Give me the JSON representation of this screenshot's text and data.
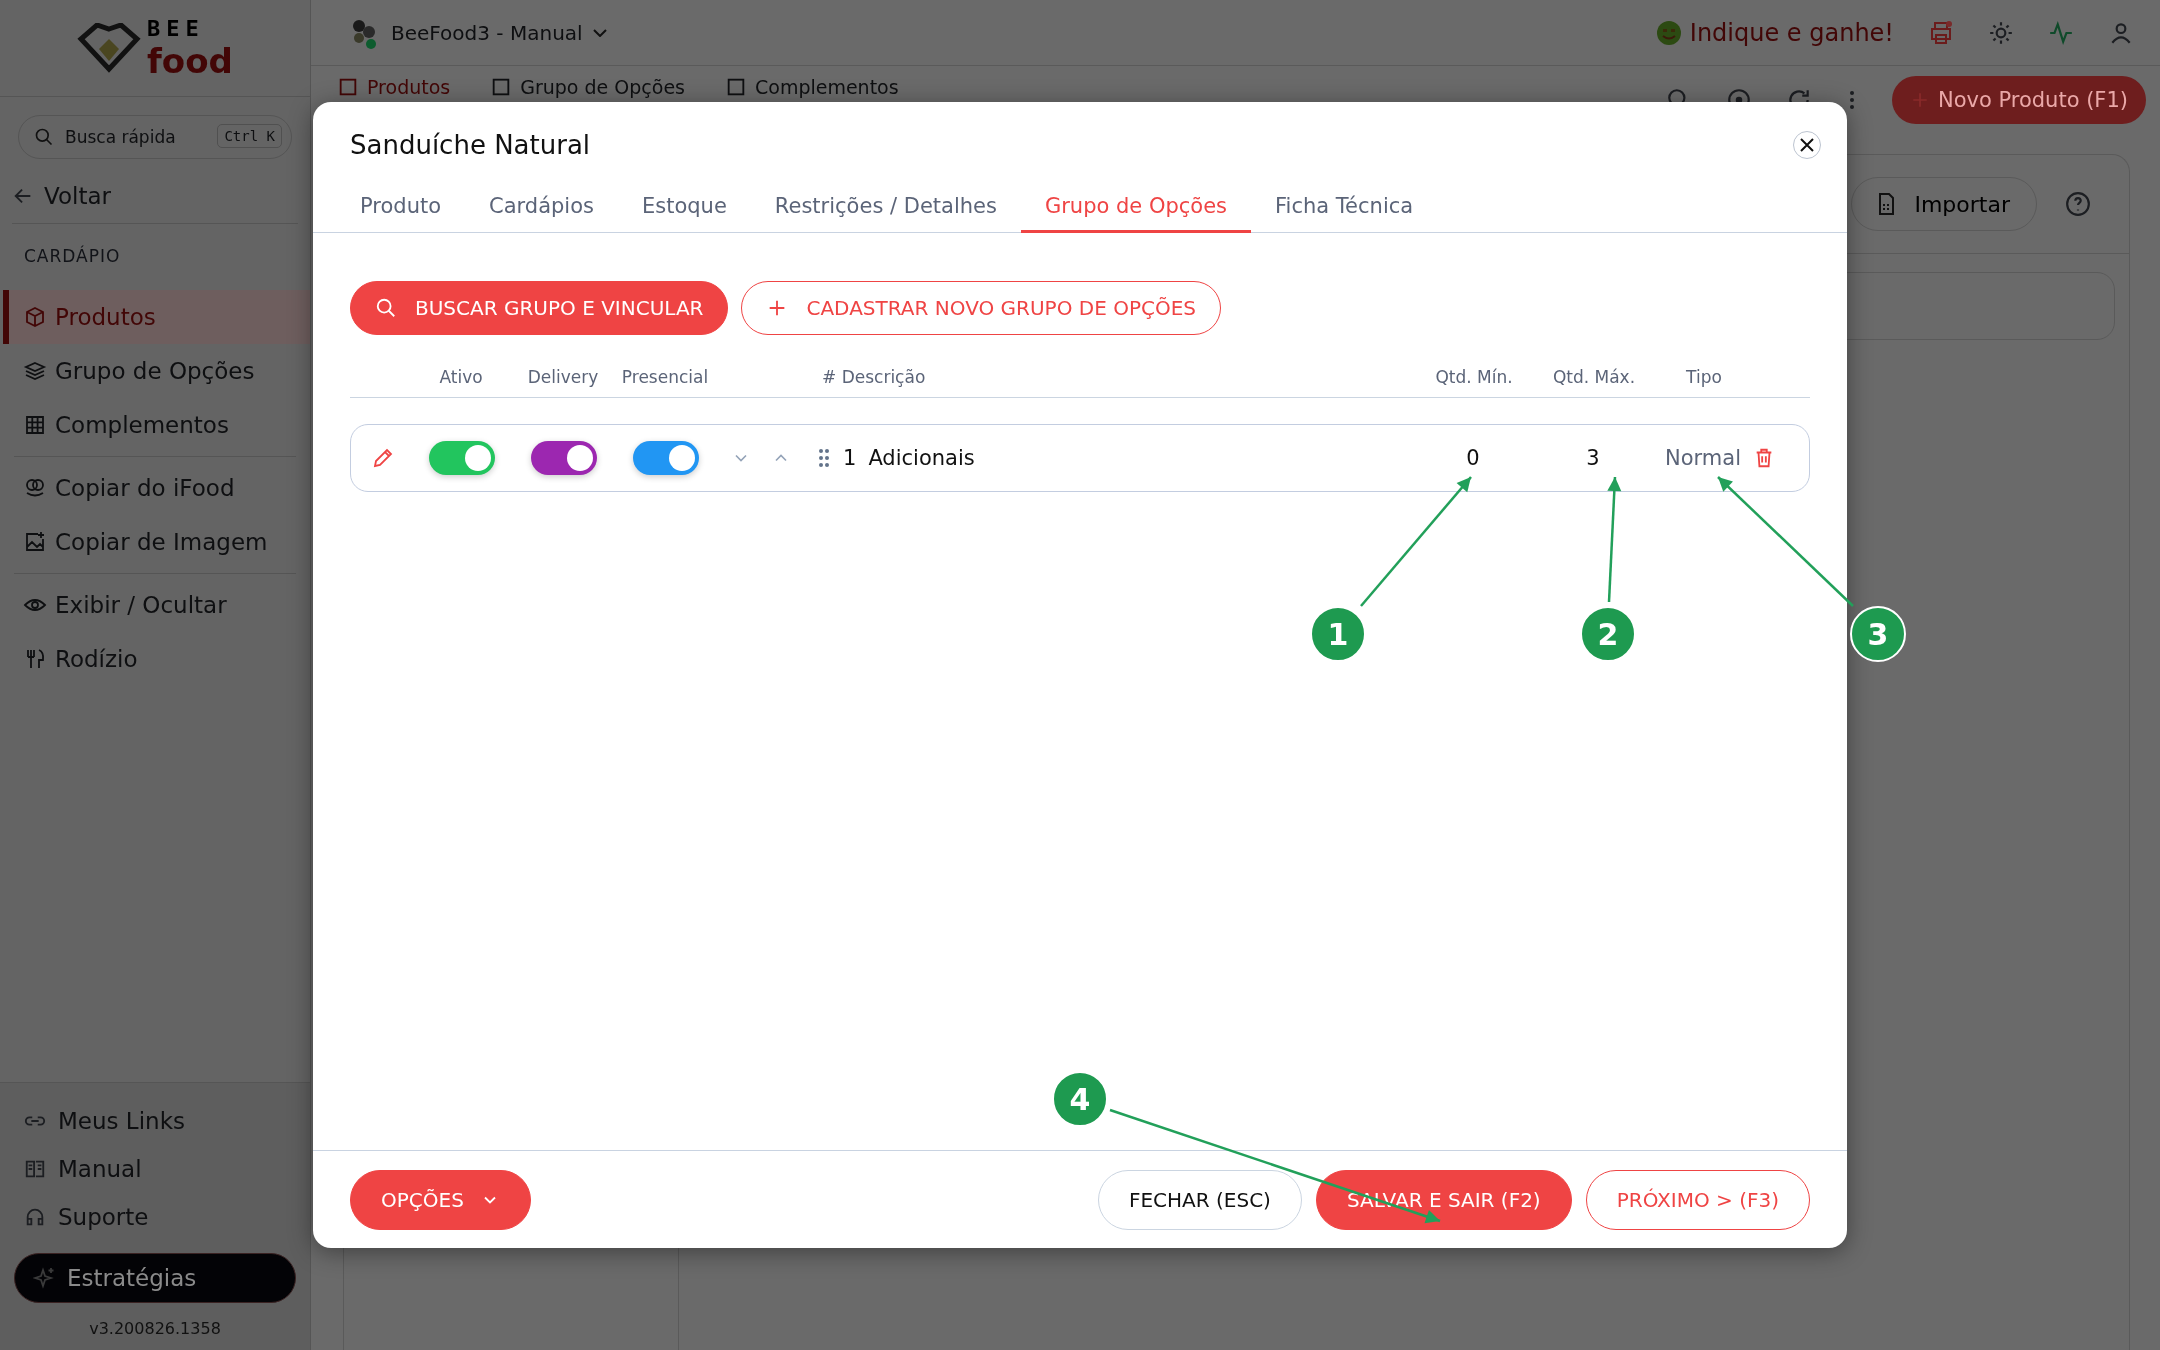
{
  "sidebar": {
    "logo": {
      "top": "BEE",
      "bottom": "food"
    },
    "search": {
      "placeholder": "Busca rápida",
      "shortcut": "Ctrl K"
    },
    "back": "Voltar",
    "section": "CARDÁPIO",
    "groups": [
      {
        "items": [
          {
            "label": "Produtos",
            "selected": true
          },
          {
            "label": "Grupo de Opções",
            "selected": false
          },
          {
            "label": "Complementos",
            "selected": false
          }
        ]
      },
      {
        "items": [
          {
            "label": "Copiar do iFood",
            "selected": false
          },
          {
            "label": "Copiar de Imagem",
            "selected": false
          }
        ]
      },
      {
        "items": [
          {
            "label": "Exibir / Ocultar",
            "selected": false
          },
          {
            "label": "Rodízio",
            "selected": false
          }
        ]
      }
    ],
    "footer_items": [
      "Meus Links",
      "Manual",
      "Suporte"
    ],
    "strategy_button": "Estratégias",
    "version": "v3.200826.1358"
  },
  "topbar": {
    "workspace": "BeeFood3 - Manual",
    "referral": "Indique e ganhe!"
  },
  "subtabs": [
    {
      "label": "Produtos",
      "selected": true
    },
    {
      "label": "Grupo de Opções",
      "selected": false
    },
    {
      "label": "Complementos",
      "selected": false
    }
  ],
  "toolbar": {
    "new_button": "Novo Produto (F1)",
    "import_button": "Importar"
  },
  "modal": {
    "title": "Sanduíche Natural",
    "tabs": [
      {
        "label": "Produto",
        "selected": false
      },
      {
        "label": "Cardápios",
        "selected": false
      },
      {
        "label": "Estoque",
        "selected": false
      },
      {
        "label": "Restrições / Detalhes",
        "selected": false
      },
      {
        "label": "Grupo de Opções",
        "selected": true
      },
      {
        "label": "Ficha Técnica",
        "selected": false
      }
    ],
    "actions": [
      {
        "kind": "filled",
        "label": "BUSCAR GRUPO E VINCULAR"
      },
      {
        "kind": "outline",
        "label": "CADASTRAR NOVO GRUPO DE OPÇÕES"
      }
    ],
    "columns": [
      "Ativo",
      "Delivery",
      "Presencial",
      "# Descrição",
      "Qtd. Mín.",
      "Qtd. Máx.",
      "Tipo"
    ],
    "rows": [
      {
        "toggles": [
          {
            "on": true,
            "color": "#22c55e"
          },
          {
            "on": true,
            "color": "#9c27b0"
          },
          {
            "on": true,
            "color": "#2196f3"
          }
        ],
        "index": "1",
        "description": "Adicionais",
        "min": "0",
        "max": "3",
        "type": "Normal"
      }
    ],
    "footer": {
      "options_button": "OPÇÕES",
      "buttons": [
        {
          "kind": "plain",
          "label": "FECHAR (ESC)"
        },
        {
          "kind": "filled",
          "label": "SALVAR E SAIR (F2)"
        },
        {
          "kind": "outline",
          "label": "PRÓXIMO > (F3)"
        }
      ]
    }
  },
  "annotations": [
    {
      "label": "1"
    },
    {
      "label": "2"
    },
    {
      "label": "3"
    },
    {
      "label": "4"
    }
  ]
}
